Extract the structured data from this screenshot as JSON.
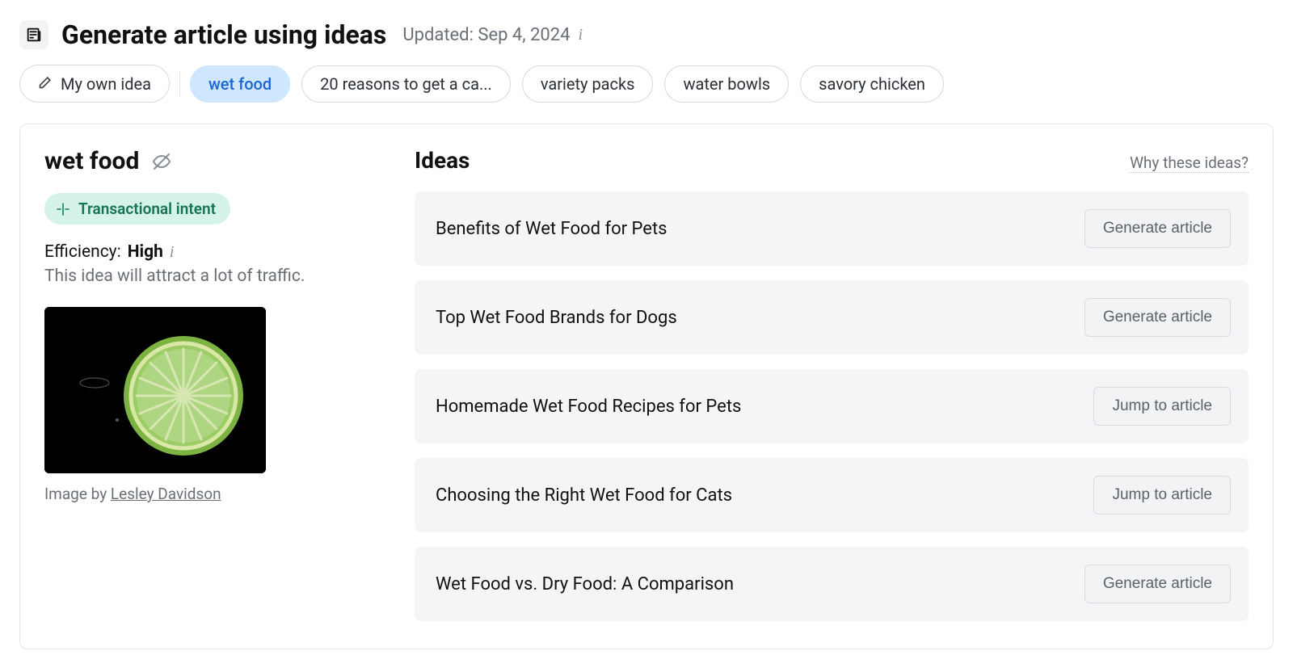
{
  "header": {
    "title": "Generate article using ideas",
    "updated": "Updated: Sep 4, 2024"
  },
  "pills": {
    "my_own": "My own idea",
    "items": [
      {
        "label": "wet food",
        "active": true
      },
      {
        "label": "20 reasons to get a ca...",
        "active": false
      },
      {
        "label": "variety packs",
        "active": false
      },
      {
        "label": "water bowls",
        "active": false
      },
      {
        "label": "savory chicken",
        "active": false
      }
    ]
  },
  "topic": {
    "title": "wet food",
    "intent_label": "Transactional intent",
    "efficiency_label": "Efficiency:",
    "efficiency_value": "High",
    "efficiency_description": "This idea will attract a lot of traffic.",
    "image_by_prefix": "Image by ",
    "image_author": "Lesley Davidson"
  },
  "ideas": {
    "heading": "Ideas",
    "why_link": "Why these ideas?",
    "action_labels": {
      "generate": "Generate article",
      "jump": "Jump to article"
    },
    "items": [
      {
        "title": "Benefits of Wet Food for Pets",
        "action": "generate"
      },
      {
        "title": "Top Wet Food Brands for Dogs",
        "action": "generate"
      },
      {
        "title": "Homemade Wet Food Recipes for Pets",
        "action": "jump"
      },
      {
        "title": "Choosing the Right Wet Food for Cats",
        "action": "jump"
      },
      {
        "title": "Wet Food vs. Dry Food: A Comparison",
        "action": "generate"
      }
    ]
  }
}
